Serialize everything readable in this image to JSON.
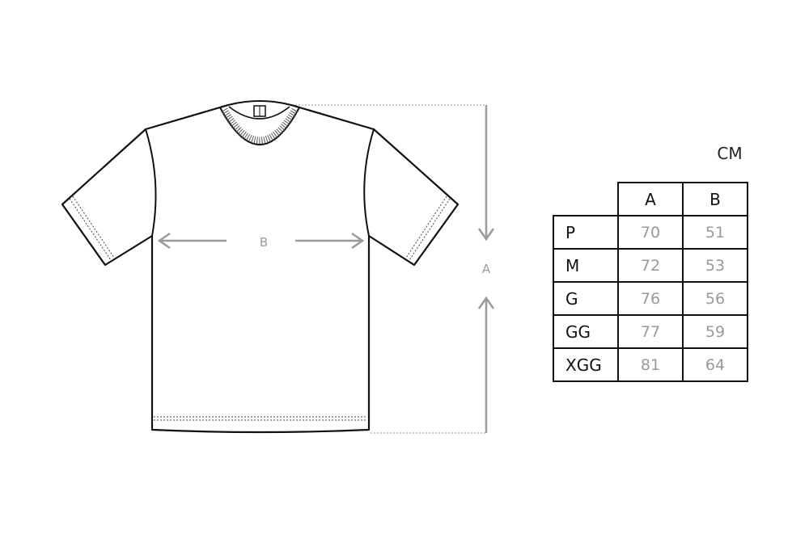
{
  "unit": "CM",
  "labels": {
    "width": "B",
    "length": "A"
  },
  "table": {
    "columns": [
      "A",
      "B"
    ],
    "rows": [
      {
        "size": "P",
        "a": "70",
        "b": "51"
      },
      {
        "size": "M",
        "a": "72",
        "b": "53"
      },
      {
        "size": "G",
        "a": "76",
        "b": "56"
      },
      {
        "size": "GG",
        "a": "77",
        "b": "59"
      },
      {
        "size": "XGG",
        "a": "81",
        "b": "64"
      }
    ]
  },
  "colors": {
    "outline": "#111111",
    "dimension": "#9a9a9a"
  }
}
